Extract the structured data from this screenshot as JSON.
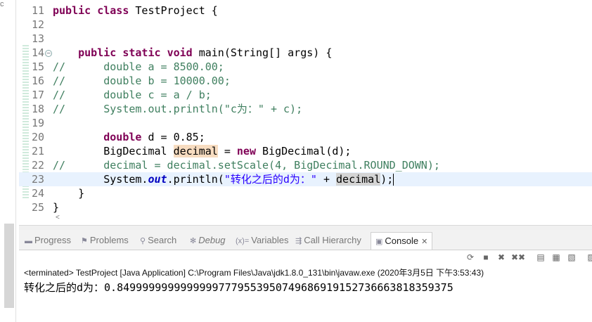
{
  "editor": {
    "lines": [
      {
        "num": "11",
        "code": [
          {
            "t": "public",
            "c": "kw"
          },
          {
            "t": " "
          },
          {
            "t": "class",
            "c": "kw"
          },
          {
            "t": " TestProject {"
          }
        ]
      },
      {
        "num": "12",
        "code": []
      },
      {
        "num": "13",
        "code": []
      },
      {
        "num": "14",
        "code": [
          {
            "t": "    "
          },
          {
            "t": "public",
            "c": "kw"
          },
          {
            "t": " "
          },
          {
            "t": "static",
            "c": "kw"
          },
          {
            "t": " "
          },
          {
            "t": "void",
            "c": "kw"
          },
          {
            "t": " main(String[] args) {"
          }
        ]
      },
      {
        "num": "15",
        "code": [
          {
            "t": "//      double a = 8500.00;",
            "c": "cm"
          }
        ]
      },
      {
        "num": "16",
        "code": [
          {
            "t": "//      double b = 10000.00;",
            "c": "cm"
          }
        ]
      },
      {
        "num": "17",
        "code": [
          {
            "t": "//      double c = a / b;",
            "c": "cm"
          }
        ]
      },
      {
        "num": "18",
        "code": [
          {
            "t": "//      System.out.println(\"c为：\" + c);",
            "c": "cm"
          }
        ]
      },
      {
        "num": "19",
        "code": []
      },
      {
        "num": "20",
        "code": [
          {
            "t": "        "
          },
          {
            "t": "double",
            "c": "kw"
          },
          {
            "t": " d = 0.85;"
          }
        ]
      },
      {
        "num": "21",
        "code": [
          {
            "t": "        BigDecimal "
          },
          {
            "t": "decimal",
            "c": "hl"
          },
          {
            "t": " = "
          },
          {
            "t": "new",
            "c": "kw"
          },
          {
            "t": " BigDecimal(d);"
          }
        ]
      },
      {
        "num": "22",
        "code": [
          {
            "t": "//      decimal = decimal.setScale(4, BigDecimal.ROUND_DOWN);",
            "c": "cm"
          }
        ]
      },
      {
        "num": "23",
        "current": true,
        "code": [
          {
            "t": "        System."
          },
          {
            "t": "out",
            "c": "fld"
          },
          {
            "t": ".println("
          },
          {
            "t": "\"转化之后的d为：\"",
            "c": "str"
          },
          {
            "t": " + "
          },
          {
            "t": "decimal",
            "c": "hl2"
          },
          {
            "t": ");"
          },
          {
            "t": "",
            "c": "caret"
          }
        ]
      },
      {
        "num": "24",
        "code": [
          {
            "t": "    }"
          }
        ]
      },
      {
        "num": "25",
        "code": [
          {
            "t": "}"
          }
        ]
      }
    ]
  },
  "outer_letter": "c",
  "tabs": [
    {
      "label": "Progress",
      "icon": "▬"
    },
    {
      "label": "Problems",
      "icon": "⚑"
    },
    {
      "label": "Search",
      "icon": "⚲"
    },
    {
      "label": "Debug",
      "icon": "✻"
    },
    {
      "label": "Variables",
      "icon": "(x)="
    },
    {
      "label": "Call Hierarchy",
      "icon": "⇶"
    },
    {
      "label": "Console",
      "icon": "▣",
      "close": "✕"
    }
  ],
  "toolbar": {
    "icons": [
      "⟳",
      "■",
      "✖",
      "✖✖",
      "▤",
      "▦",
      "▧",
      "▨"
    ]
  },
  "console": {
    "header": "<terminated> TestProject [Java Application] C:\\Program Files\\Java\\jdk1.8.0_131\\bin\\javaw.exe (2020年3月5日 下午3:53:43)",
    "output": "转化之后的d为：0.84999999999999997779553950749686919152736663818359375"
  },
  "colors": {
    "keyword": "#7f0055",
    "comment": "#3f7f5f",
    "string": "#2a00ff",
    "current_line": "#e8f2fe"
  }
}
